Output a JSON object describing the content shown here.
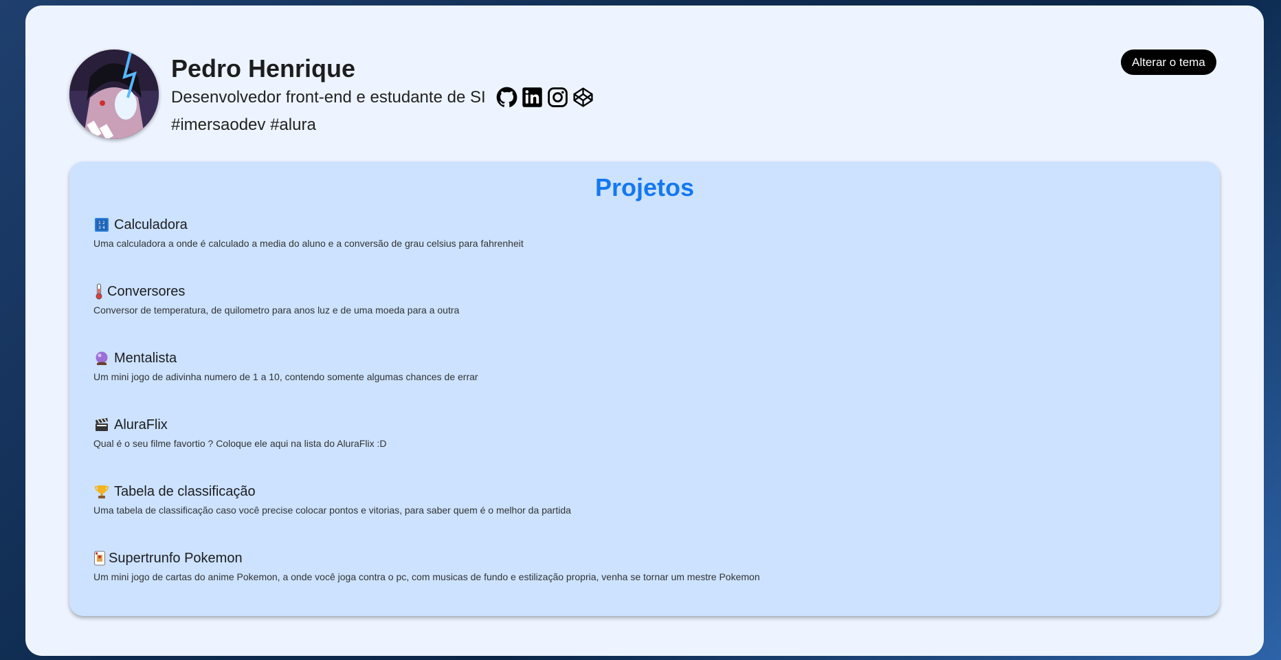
{
  "profile": {
    "name": "Pedro Henrique",
    "subtitle": "Desenvolvedor front-end e estudante de SI",
    "hashtags": "#imersaodev #alura",
    "socials": [
      "github-icon",
      "linkedin-icon",
      "instagram-icon",
      "codepen-icon"
    ]
  },
  "theme_button": "Alterar o tema",
  "projects": {
    "title": "Projetos",
    "items": [
      {
        "icon": "input-numbers-emoji",
        "name": "Calculadora",
        "description": "Uma calculadora a onde é calculado a media do aluno e a conversão de grau celsius para fahrenheit"
      },
      {
        "icon": "thermometer-emoji",
        "name": "Conversores",
        "description": "Conversor de temperatura, de quilometro para anos luz e de uma moeda para a outra"
      },
      {
        "icon": "crystal-ball-emoji",
        "name": "Mentalista",
        "description": "Um mini jogo de adivinha numero de 1 a 10, contendo somente algumas chances de errar"
      },
      {
        "icon": "clapper-board-emoji",
        "name": "AluraFlix",
        "description": "Qual é o seu filme favortio ? Coloque ele aqui na lista do AluraFlix :D"
      },
      {
        "icon": "trophy-emoji",
        "name": "Tabela de classificação",
        "description": "Uma tabela de classificação caso você precise colocar pontos e vitorias, para saber quem é o melhor da partida"
      },
      {
        "icon": "playing-card-emoji",
        "name": "Supertrunfo Pokemon",
        "description": "Um mini jogo de cartas do anime Pokemon, a onde você joga contra o pc, com musicas de fundo e estilização propria, venha se tornar um mestre Pokemon"
      }
    ]
  },
  "colors": {
    "card_bg": "#edf4ff",
    "projects_bg": "#cce2ff",
    "accent": "#1478f0",
    "button_bg": "#000000"
  }
}
